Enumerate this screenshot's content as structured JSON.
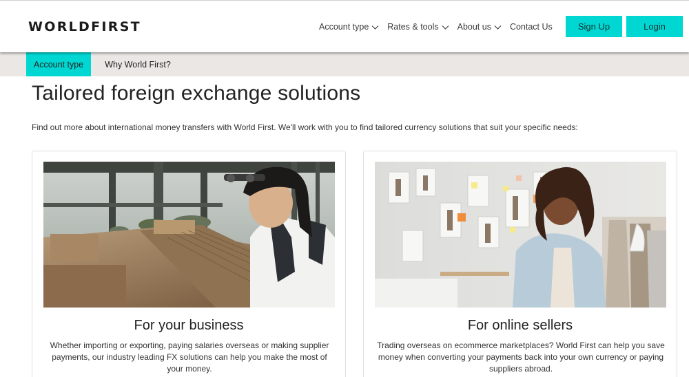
{
  "header": {
    "logo": "WORLDFIRST",
    "nav": [
      {
        "label": "Account type",
        "has_dropdown": true
      },
      {
        "label": "Rates & tools",
        "has_dropdown": true
      },
      {
        "label": "About us",
        "has_dropdown": true
      },
      {
        "label": "Contact Us",
        "has_dropdown": false
      }
    ],
    "signup_label": "Sign Up",
    "login_label": "Login"
  },
  "subnav": {
    "tabs": [
      {
        "label": "Account type",
        "active": true
      },
      {
        "label": "Why World First?",
        "active": false
      }
    ]
  },
  "main": {
    "title": "Tailored foreign exchange solutions",
    "intro": "Find out more about international money transfers with World First. We'll work with you to find tailored currency solutions that suit your specific needs:",
    "cards": [
      {
        "title": "For your business",
        "text": "Whether importing or exporting, paying salaries overseas or making supplier payments, our industry leading FX solutions can help you make the most of your money."
      },
      {
        "title": "For online sellers",
        "text": "Trading overseas on ecommerce marketplaces? World First can help you save money when converting your payments back into your own currency or paying suppliers abroad."
      }
    ]
  },
  "colors": {
    "accent": "#00d7d2",
    "subnav_bg": "#eae7e4",
    "text": "#222222"
  }
}
